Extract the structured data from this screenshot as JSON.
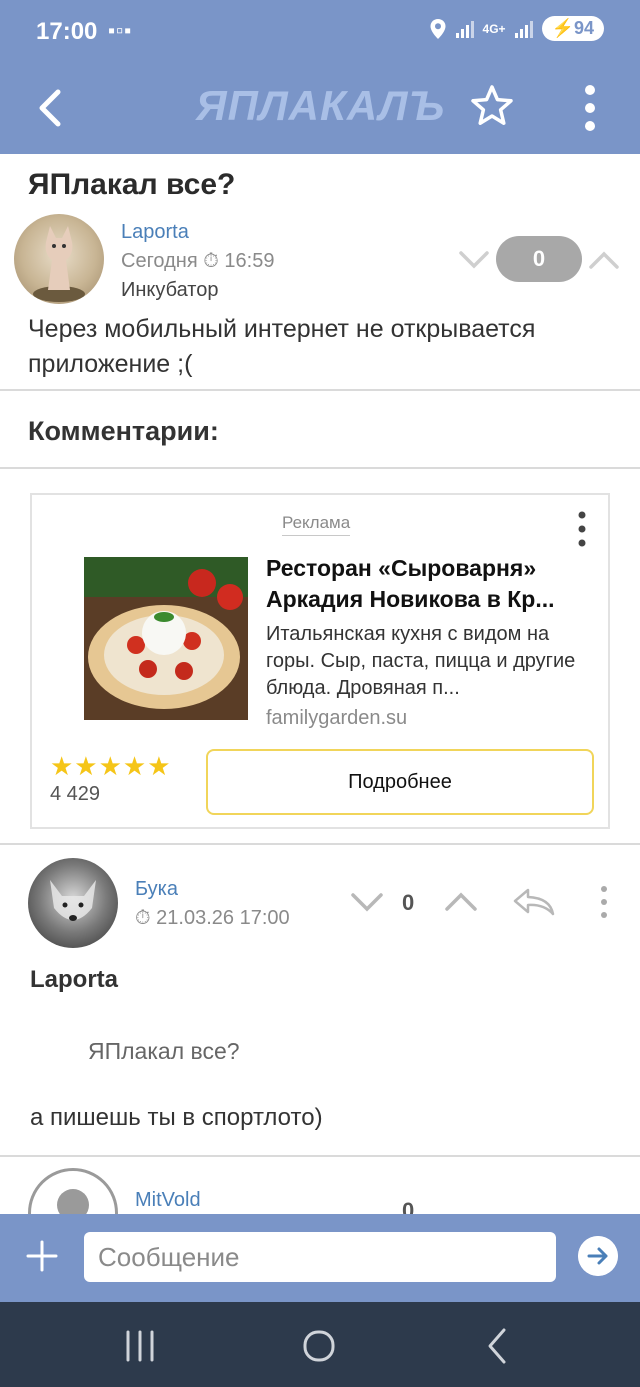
{
  "status_bar": {
    "time": "17:00",
    "network": "4G+",
    "battery": "94"
  },
  "app_bar": {
    "logo": "ЯПЛАКАЛЪ"
  },
  "post": {
    "title": "ЯПлакал все?",
    "author": "Laporta",
    "date": "Сегодня",
    "time": "16:59",
    "rank": "Инкубатор",
    "score": "0",
    "body": "Через мобильный интернет не открывается приложение ;("
  },
  "comments_header": "Комментарии:",
  "ad": {
    "label": "Реклама",
    "title": "Ресторан «Сыроварня» Аркадия Новикова в Кр...",
    "description": "Итальянская кухня с видом на горы. Сыр, паста, пицца и другие блюда. Дровяная п...",
    "domain": "familygarden.su",
    "stars": "★★★★★",
    "rating_count": "4 429",
    "button_label": "Подробнее"
  },
  "comments": [
    {
      "author": "Бука",
      "datetime": "21.03.26 17:00",
      "score": "0",
      "quote_author": "Laporta",
      "quote_text": "ЯПлакал все?",
      "text": "а пишешь ты в спортлото)"
    },
    {
      "author": "MitVold",
      "score": "0"
    }
  ],
  "composer": {
    "placeholder": "Сообщение"
  },
  "colors": {
    "header": "#7a95c8",
    "link": "#4a7fb8",
    "nav_bar": "#2d3a4c",
    "star": "#f5c518",
    "ad_button_border": "#f1d55a"
  }
}
